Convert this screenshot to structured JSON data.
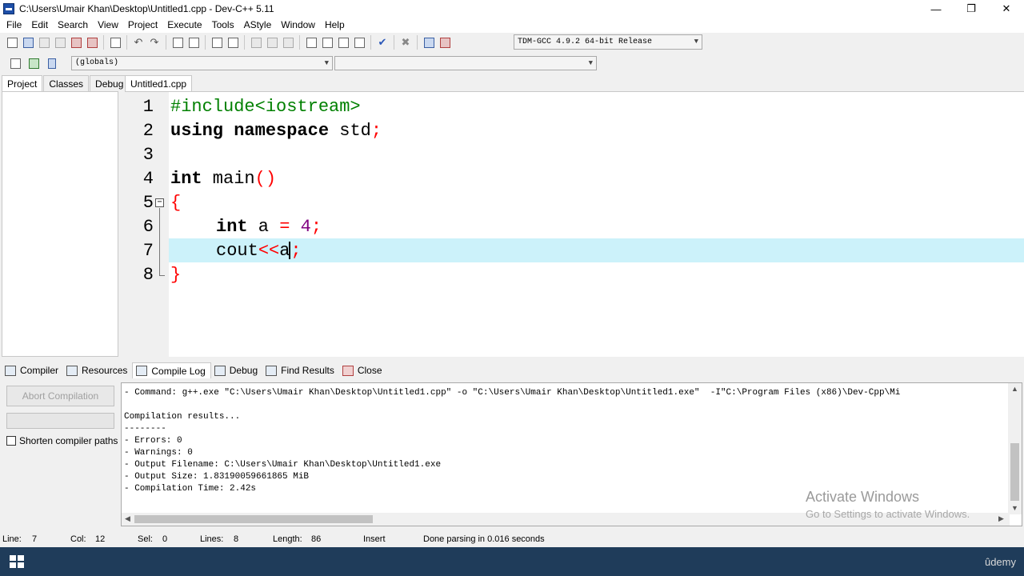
{
  "window": {
    "title": "C:\\Users\\Umair Khan\\Desktop\\Untitled1.cpp - Dev-C++ 5.11",
    "controls": {
      "minimize": "—",
      "maximize": "❐",
      "close": "✕"
    }
  },
  "menu": [
    "File",
    "Edit",
    "Search",
    "View",
    "Project",
    "Execute",
    "Tools",
    "AStyle",
    "Window",
    "Help"
  ],
  "toolbar": {
    "compiler": "TDM-GCC 4.9.2 64-bit Release"
  },
  "toolbar2": {
    "scope": "(globals)",
    "members": ""
  },
  "left_tabs": [
    "Project",
    "Classes",
    "Debug"
  ],
  "file_tab": "Untitled1.cpp",
  "editor": {
    "current_line": 7,
    "lines": [
      {
        "n": "1"
      },
      {
        "n": "2"
      },
      {
        "n": "3"
      },
      {
        "n": "4"
      },
      {
        "n": "5"
      },
      {
        "n": "6"
      },
      {
        "n": "7"
      },
      {
        "n": "8"
      }
    ],
    "tokens": {
      "l1": "#include<iostream>",
      "l2a": "using namespace",
      "l2b": " std",
      "l2c": ";",
      "l4a": "int",
      "l4b": " main",
      "l4c": "()",
      "l5": "{",
      "l6a": "int",
      "l6b": " a ",
      "l6c": "=",
      "l6d": " 4",
      "l6e": ";",
      "l7a": "cout",
      "l7b": "<<",
      "l7c": "a",
      "l7d": ";",
      "l8": "}"
    }
  },
  "bottom_tabs": [
    "Compiler",
    "Resources",
    "Compile Log",
    "Debug",
    "Find Results",
    "Close"
  ],
  "bottom": {
    "abort_button": "Abort Compilation",
    "shorten_paths": "Shorten compiler paths",
    "log": [
      "- Command: g++.exe \"C:\\Users\\Umair Khan\\Desktop\\Untitled1.cpp\" -o \"C:\\Users\\Umair Khan\\Desktop\\Untitled1.exe\"  -I\"C:\\Program Files (x86)\\Dev-Cpp\\Mi",
      "",
      "Compilation results...",
      "--------",
      "- Errors: 0",
      "- Warnings: 0",
      "- Output Filename: C:\\Users\\Umair Khan\\Desktop\\Untitled1.exe",
      "- Output Size: 1.83190059661865 MiB",
      "- Compilation Time: 2.42s"
    ]
  },
  "watermark": {
    "line1": "Activate Windows",
    "line2": "Go to Settings to activate Windows."
  },
  "status": {
    "line_label": "Line:",
    "line_value": "7",
    "col_label": "Col:",
    "col_value": "12",
    "sel_label": "Sel:",
    "sel_value": "0",
    "lines_label": "Lines:",
    "lines_value": "8",
    "length_label": "Length:",
    "length_value": "86",
    "mode": "Insert",
    "message": "Done parsing in 0.016 seconds"
  },
  "taskbar": {
    "brand": "ûdemy"
  },
  "colors": {
    "current_line": "#ccf2fa",
    "keyword": "#000000",
    "preprocessor": "#008000",
    "symbol": "#ff0000",
    "number": "#800080"
  }
}
